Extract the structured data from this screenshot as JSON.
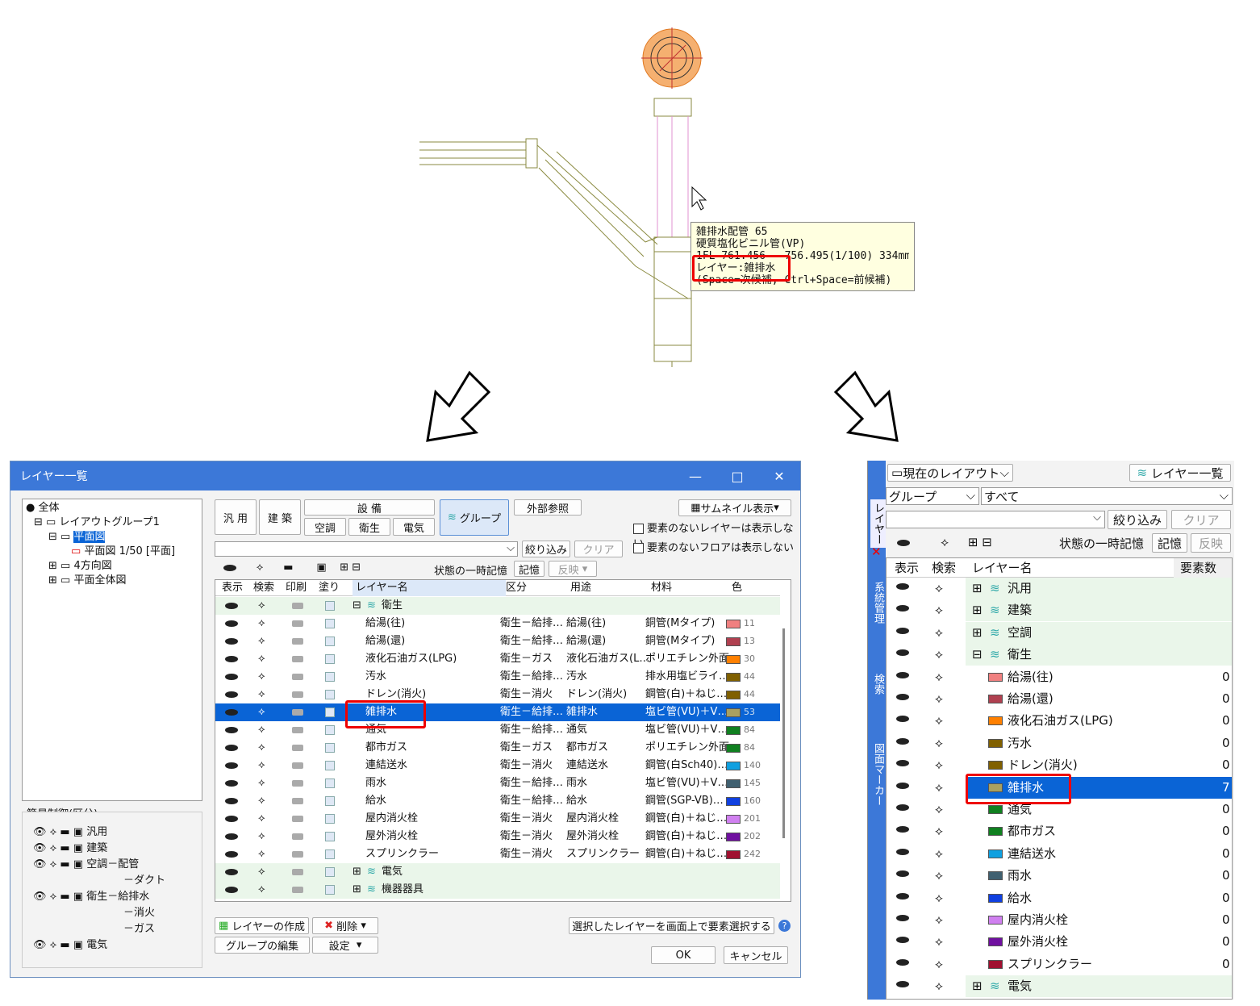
{
  "tooltip": {
    "line1": "雑排水配管 65",
    "line2": "硬質塩化ビニル管(VP)",
    "line3": "1FL-761.456 - 756.495(1/100) 334mm",
    "line4": "レイヤー:雑排水",
    "line5": "(Space=次候補, Ctrl+Space=前候補)"
  },
  "dialog": {
    "title": "レイヤー一覧",
    "controls": {
      "minimize": "—",
      "maximize": "□",
      "close": "✕"
    },
    "tree": [
      "全体",
      "レイアウトグループ1",
      "平面図",
      "平面図 1/50 [平面]",
      "4方向図",
      "平面全体図"
    ],
    "simple_label": "簡易制御(区分)",
    "simple_items": [
      "汎用",
      "建築",
      "空調－配管",
      "－ダクト",
      "衛生－給排水",
      "－消火",
      "－ガス",
      "電気"
    ],
    "cat_buttons": {
      "general": "汎 用",
      "arch": "建 築",
      "equip": "設 備",
      "hvac": "空調",
      "sanitary": "衛生",
      "electric": "電気",
      "group": "グループ",
      "xref": "外部参照"
    },
    "thumbnail": "サムネイル表示",
    "opt1": "要素のないレイヤーは表示しない",
    "opt2": "要素のないフロアは表示しない",
    "filter": "絞り込み",
    "clear": "クリア",
    "state_label": "状態の一時記憶",
    "memo": "記憶",
    "reflect": "反映",
    "headers": [
      "表示",
      "検索",
      "印刷",
      "塗り",
      "レイヤー名",
      "区分",
      "用途",
      "材料",
      "色"
    ],
    "group_sanitary": "衛生",
    "rows": [
      {
        "name": "給湯(往)",
        "kubun": "衛生－給排…",
        "yoto": "給湯(往)",
        "zai": "銅管(Mタイプ)",
        "color": "#f08080",
        "num": "11"
      },
      {
        "name": "給湯(還)",
        "kubun": "衛生－給排…",
        "yoto": "給湯(還)",
        "zai": "銅管(Mタイプ)",
        "color": "#b04050",
        "num": "13"
      },
      {
        "name": "液化石油ガス(LPG)",
        "kubun": "衛生－ガス",
        "yoto": "液化石油ガス(L…",
        "zai": "ポリエチレン外面…",
        "color": "#ff8000",
        "num": "30"
      },
      {
        "name": "汚水",
        "kubun": "衛生－給排…",
        "yoto": "汚水",
        "zai": "排水用塩ビライ…",
        "color": "#806000",
        "num": "44"
      },
      {
        "name": "ドレン(消火)",
        "kubun": "衛生－消火",
        "yoto": "ドレン(消火)",
        "zai": "鋼管(白)＋ねじ…",
        "color": "#806000",
        "num": "44"
      },
      {
        "name": "雑排水",
        "kubun": "衛生－給排…",
        "yoto": "雑排水",
        "zai": "塩ビ管(VU)＋V…",
        "color": "#a8a060",
        "num": "53"
      },
      {
        "name": "通気",
        "kubun": "衛生－給排…",
        "yoto": "通気",
        "zai": "塩ビ管(VU)＋V…",
        "color": "#108020",
        "num": "84"
      },
      {
        "name": "都市ガス",
        "kubun": "衛生－ガス",
        "yoto": "都市ガス",
        "zai": "ポリエチレン外面…",
        "color": "#108020",
        "num": "84"
      },
      {
        "name": "連結送水",
        "kubun": "衛生－消火",
        "yoto": "連結送水",
        "zai": "鋼管(白Sch40)…",
        "color": "#10a0e0",
        "num": "140"
      },
      {
        "name": "雨水",
        "kubun": "衛生－給排…",
        "yoto": "雨水",
        "zai": "塩ビ管(VU)＋V…",
        "color": "#406070",
        "num": "145"
      },
      {
        "name": "給水",
        "kubun": "衛生－給排…",
        "yoto": "給水",
        "zai": "鋼管(SGP-VB)…",
        "color": "#1040e0",
        "num": "160"
      },
      {
        "name": "屋内消火栓",
        "kubun": "衛生－消火",
        "yoto": "屋内消火栓",
        "zai": "鋼管(白)＋ねじ…",
        "color": "#d080f0",
        "num": "201"
      },
      {
        "name": "屋外消火栓",
        "kubun": "衛生－消火",
        "yoto": "屋外消火栓",
        "zai": "鋼管(白)＋ねじ…",
        "color": "#7010a0",
        "num": "202"
      },
      {
        "name": "スプリンクラー",
        "kubun": "衛生－消火",
        "yoto": "スプリンクラー",
        "zai": "鋼管(白)＋ねじ…",
        "color": "#a01030",
        "num": "242"
      }
    ],
    "group_electric": "電気",
    "group_equip": "機器器具",
    "create": "レイヤーの作成",
    "delete": "削除",
    "select_on_screen": "選択したレイヤーを画面上で要素選択する",
    "edit_group": "グループの編集",
    "settings": "設定",
    "ok": "OK",
    "cancel": "キャンセル"
  },
  "right": {
    "side_tabs": [
      "レイヤー",
      "系統管理",
      "検索",
      "図面マーカー"
    ],
    "layout": "現在のレイアウト",
    "layer_list": "レイヤー一覧",
    "group_select": "グループ",
    "all_select": "すべて",
    "filter": "絞り込み",
    "clear": "クリア",
    "state_label": "状態の一時記憶",
    "memo": "記憶",
    "reflect": "反映",
    "headers": [
      "表示",
      "検索",
      "レイヤー名",
      "要素数"
    ],
    "groups_top": [
      "汎用",
      "建築",
      "空調",
      "衛生"
    ],
    "rows": [
      {
        "name": "給湯(往)",
        "color": "#f08080",
        "count": "0"
      },
      {
        "name": "給湯(還)",
        "color": "#b04050",
        "count": "0"
      },
      {
        "name": "液化石油ガス(LPG)",
        "color": "#ff8000",
        "count": "0"
      },
      {
        "name": "汚水",
        "color": "#806000",
        "count": "0"
      },
      {
        "name": "ドレン(消火)",
        "color": "#806000",
        "count": "0"
      },
      {
        "name": "雑排水",
        "color": "#a8a060",
        "count": "7"
      },
      {
        "name": "通気",
        "color": "#108020",
        "count": "0"
      },
      {
        "name": "都市ガス",
        "color": "#108020",
        "count": "0"
      },
      {
        "name": "連結送水",
        "color": "#10a0e0",
        "count": "0"
      },
      {
        "name": "雨水",
        "color": "#406070",
        "count": "0"
      },
      {
        "name": "給水",
        "color": "#1040e0",
        "count": "0"
      },
      {
        "name": "屋内消火栓",
        "color": "#d080f0",
        "count": "0"
      },
      {
        "name": "屋外消火栓",
        "color": "#7010a0",
        "count": "0"
      },
      {
        "name": "スプリンクラー",
        "color": "#a01030",
        "count": "0"
      }
    ],
    "group_bottom": "電気"
  }
}
